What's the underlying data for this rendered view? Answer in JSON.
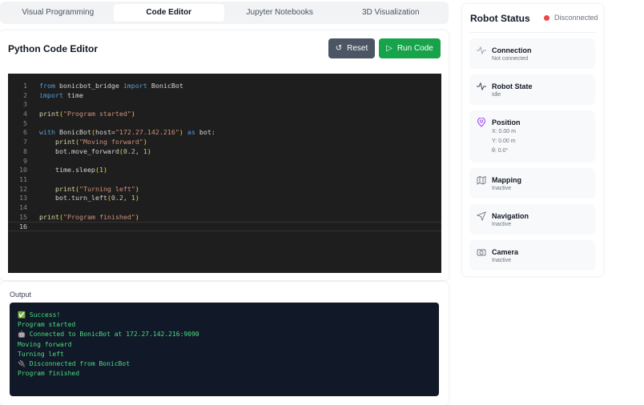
{
  "tabs": [
    "Visual Programming",
    "Code Editor",
    "Jupyter Notebooks",
    "3D Visualization"
  ],
  "editor": {
    "title": "Python Code Editor",
    "reset_label": "Reset",
    "run_label": "Run Code",
    "lines": [
      [
        [
          "kw",
          "from "
        ],
        [
          "tx",
          "bonicbot_bridge "
        ],
        [
          "kw",
          "import "
        ],
        [
          "tx",
          "BonicBot"
        ]
      ],
      [
        [
          "kw",
          "import "
        ],
        [
          "tx",
          "time"
        ]
      ],
      [],
      [
        [
          "fn",
          "print"
        ],
        [
          "pa",
          "("
        ],
        [
          "st",
          "\"Program started\""
        ],
        [
          "pa",
          ")"
        ]
      ],
      [],
      [
        [
          "kw",
          "with "
        ],
        [
          "tx",
          "BonicBot"
        ],
        [
          "pa",
          "("
        ],
        [
          "tx",
          "host="
        ],
        [
          "st",
          "\"172.27.142.216\""
        ],
        [
          "pa",
          ")"
        ],
        [
          "kw",
          " as "
        ],
        [
          "tx",
          "bot:"
        ]
      ],
      [
        [
          "tx",
          "    "
        ],
        [
          "fn",
          "print"
        ],
        [
          "pa",
          "("
        ],
        [
          "st",
          "\"Moving forward\""
        ],
        [
          "pa",
          ")"
        ]
      ],
      [
        [
          "tx",
          "    bot.move_forward"
        ],
        [
          "pa",
          "("
        ],
        [
          "nu",
          "0.2"
        ],
        [
          "tx",
          ", "
        ],
        [
          "nu",
          "1"
        ],
        [
          "pa",
          ")"
        ]
      ],
      [],
      [
        [
          "tx",
          "    time.sleep"
        ],
        [
          "pa",
          "("
        ],
        [
          "nu",
          "1"
        ],
        [
          "pa",
          ")"
        ]
      ],
      [],
      [
        [
          "tx",
          "    "
        ],
        [
          "fn",
          "print"
        ],
        [
          "pa",
          "("
        ],
        [
          "st",
          "\"Turning left\""
        ],
        [
          "pa",
          ")"
        ]
      ],
      [
        [
          "tx",
          "    bot.turn_left"
        ],
        [
          "pa",
          "("
        ],
        [
          "nu",
          "0.2"
        ],
        [
          "tx",
          ", "
        ],
        [
          "nu",
          "1"
        ],
        [
          "pa",
          ")"
        ]
      ],
      [],
      [
        [
          "fn",
          "print"
        ],
        [
          "pa",
          "("
        ],
        [
          "st",
          "\"Program finished\""
        ],
        [
          "pa",
          ")"
        ]
      ],
      []
    ]
  },
  "output": {
    "label": "Output",
    "lines": [
      "✅ Success!",
      "",
      "Program started",
      "🤖 Connected to BonicBot at 172.27.142.216:9090",
      "Moving forward",
      "Turning left",
      "🔌 Disconnected from BonicBot",
      "Program finished"
    ]
  },
  "status": {
    "title": "Robot Status",
    "badge": "Disconnected",
    "accent": "#ef4444",
    "connection": {
      "title": "Connection",
      "value": "Not connected"
    },
    "state": {
      "title": "Robot State",
      "value": "Idle"
    },
    "position": {
      "title": "Position",
      "x": "X: 0.00 m",
      "y": "Y: 0.00 m",
      "theta": "θ: 0.0°"
    },
    "mapping": {
      "title": "Mapping",
      "value": "Inactive"
    },
    "navigation": {
      "title": "Navigation",
      "value": "Inactive"
    },
    "camera": {
      "title": "Camera",
      "value": "Inactive"
    }
  }
}
